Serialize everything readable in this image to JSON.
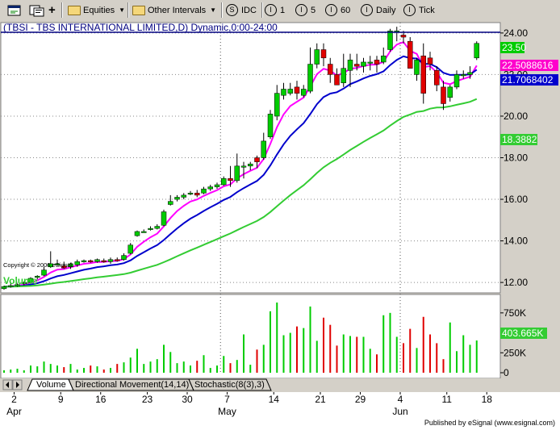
{
  "toolbar": {
    "equities": "Equities",
    "intervals": "Other Intervals",
    "idc": "IDC",
    "i1": "1",
    "i5": "5",
    "i60": "60",
    "daily": "Daily",
    "tick": "Tick",
    "idc_glyph": "S",
    "i1_glyph": "I",
    "i5_glyph": "I",
    "i60_glyph": "I",
    "daily_glyph": "I",
    "tick_glyph": "I"
  },
  "chart": {
    "title": "(TBSI - TBS INTERNATIONAL LIMITED,D) Dynamic,0:00-24:00",
    "copyright": "Copyright © 2006 eSignal.",
    "price_labels": {
      "close": "23.50",
      "ma_short": "22.5088616",
      "ma_mid": "21.7068402",
      "ma_long": "18.3882"
    },
    "volume_title": "Volume",
    "volume_value": "403.665K",
    "published": "Published by eSignal (www.esignal.com)",
    "colors": {
      "up": "#00cc00",
      "down": "#e00000",
      "ma_short": "#ff00ff",
      "ma_mid": "#0000cc",
      "ma_long": "#33cc33",
      "close_label": "#00cc00",
      "ma_short_label": "#ff00cc",
      "ma_mid_label": "#0000cc",
      "ma_long_label": "#33cc33"
    }
  },
  "tabs": [
    "Volume",
    "Directional Movement(14,14)",
    "Stochastic(8(3),3)"
  ],
  "chart_data": {
    "type": "candlestick",
    "x_ticks": [
      "2",
      "9",
      "16",
      "23",
      "30",
      "7",
      "14",
      "21",
      "29",
      "4",
      "11",
      "18"
    ],
    "month_labels": [
      "Apr",
      "May",
      "Jun"
    ],
    "price_ticks": [
      "24.00",
      "22.00",
      "20.00",
      "18.00",
      "16.00",
      "14.00",
      "12.00"
    ],
    "volume_ticks": [
      "750K",
      "500K",
      "250K",
      "0"
    ],
    "ylim": [
      11.5,
      24.5
    ],
    "volume_ylim": [
      0,
      900
    ],
    "candles": [
      {
        "o": 11.7,
        "h": 11.85,
        "l": 11.65,
        "c": 11.8,
        "v": 30
      },
      {
        "o": 11.8,
        "h": 11.95,
        "l": 11.75,
        "c": 11.85,
        "v": 40
      },
      {
        "o": 11.85,
        "h": 11.95,
        "l": 11.8,
        "c": 11.9,
        "v": 50
      },
      {
        "o": 11.95,
        "h": 12.05,
        "l": 11.85,
        "c": 12.0,
        "v": 30
      },
      {
        "o": 12.0,
        "h": 12.25,
        "l": 11.95,
        "c": 12.2,
        "v": 90
      },
      {
        "o": 12.25,
        "h": 12.35,
        "l": 12.15,
        "c": 12.3,
        "v": 80
      },
      {
        "o": 12.35,
        "h": 12.75,
        "l": 12.3,
        "c": 12.6,
        "v": 140
      },
      {
        "o": 12.75,
        "h": 13.5,
        "l": 12.7,
        "c": 12.9,
        "v": 110
      },
      {
        "o": 12.9,
        "h": 13.1,
        "l": 12.8,
        "c": 12.9,
        "v": 90
      },
      {
        "o": 12.8,
        "h": 13.0,
        "l": 12.65,
        "c": 12.7,
        "v": 70
      },
      {
        "o": 12.75,
        "h": 12.95,
        "l": 12.65,
        "c": 12.9,
        "v": 110
      },
      {
        "o": 12.85,
        "h": 13.1,
        "l": 12.75,
        "c": 13.0,
        "v": 40
      },
      {
        "o": 13.0,
        "h": 13.1,
        "l": 12.95,
        "c": 13.05,
        "v": 60
      },
      {
        "o": 13.05,
        "h": 13.1,
        "l": 12.95,
        "c": 13.0,
        "v": 90
      },
      {
        "o": 13.0,
        "h": 13.15,
        "l": 12.95,
        "c": 13.1,
        "v": 80
      },
      {
        "o": 13.05,
        "h": 13.15,
        "l": 12.95,
        "c": 13.0,
        "v": 40
      },
      {
        "o": 13.0,
        "h": 13.2,
        "l": 12.9,
        "c": 13.1,
        "v": 60
      },
      {
        "o": 13.1,
        "h": 13.2,
        "l": 13.0,
        "c": 13.05,
        "v": 110
      },
      {
        "o": 13.1,
        "h": 13.4,
        "l": 13.05,
        "c": 13.3,
        "v": 130
      },
      {
        "o": 13.4,
        "h": 13.9,
        "l": 13.35,
        "c": 13.8,
        "v": 190
      },
      {
        "o": 14.25,
        "h": 14.5,
        "l": 14.2,
        "c": 14.45,
        "v": 300
      },
      {
        "o": 14.45,
        "h": 14.55,
        "l": 14.4,
        "c": 14.45,
        "v": 110
      },
      {
        "o": 14.55,
        "h": 14.7,
        "l": 14.5,
        "c": 14.6,
        "v": 140
      },
      {
        "o": 14.6,
        "h": 14.8,
        "l": 14.55,
        "c": 14.7,
        "v": 170
      },
      {
        "o": 14.75,
        "h": 15.5,
        "l": 14.7,
        "c": 15.4,
        "v": 350
      },
      {
        "o": 15.75,
        "h": 16.2,
        "l": 15.7,
        "c": 15.9,
        "v": 260
      },
      {
        "o": 16.0,
        "h": 16.2,
        "l": 15.9,
        "c": 16.1,
        "v": 120
      },
      {
        "o": 16.1,
        "h": 16.3,
        "l": 16.0,
        "c": 16.2,
        "v": 140
      },
      {
        "o": 16.25,
        "h": 16.4,
        "l": 16.2,
        "c": 16.3,
        "v": 90
      },
      {
        "o": 16.3,
        "h": 16.45,
        "l": 16.1,
        "c": 16.2,
        "v": 150
      },
      {
        "o": 16.3,
        "h": 16.6,
        "l": 16.25,
        "c": 16.5,
        "v": 220
      },
      {
        "o": 16.5,
        "h": 16.7,
        "l": 16.4,
        "c": 16.6,
        "v": 60
      },
      {
        "o": 16.6,
        "h": 16.8,
        "l": 16.5,
        "c": 16.7,
        "v": 90
      },
      {
        "o": 16.7,
        "h": 17.1,
        "l": 16.65,
        "c": 17.0,
        "v": 210
      },
      {
        "o": 17.0,
        "h": 17.6,
        "l": 16.6,
        "c": 16.9,
        "v": 120
      },
      {
        "o": 16.9,
        "h": 18.2,
        "l": 16.8,
        "c": 17.6,
        "v": 160
      },
      {
        "o": 17.6,
        "h": 17.8,
        "l": 17.0,
        "c": 17.6,
        "v": 480
      },
      {
        "o": 17.6,
        "h": 17.8,
        "l": 17.4,
        "c": 17.7,
        "v": 100
      },
      {
        "o": 18.0,
        "h": 18.1,
        "l": 17.5,
        "c": 17.8,
        "v": 290
      },
      {
        "o": 18.0,
        "h": 19.2,
        "l": 17.9,
        "c": 18.8,
        "v": 350
      },
      {
        "o": 19.0,
        "h": 20.3,
        "l": 18.9,
        "c": 20.1,
        "v": 770
      },
      {
        "o": 20.0,
        "h": 21.5,
        "l": 19.8,
        "c": 21.1,
        "v": 880
      },
      {
        "o": 21.0,
        "h": 21.6,
        "l": 20.8,
        "c": 21.3,
        "v": 470
      },
      {
        "o": 21.1,
        "h": 21.6,
        "l": 21.0,
        "c": 21.3,
        "v": 500
      },
      {
        "o": 21.4,
        "h": 21.7,
        "l": 20.8,
        "c": 21.1,
        "v": 580
      },
      {
        "o": 21.0,
        "h": 21.5,
        "l": 20.9,
        "c": 21.3,
        "v": 560
      },
      {
        "o": 21.2,
        "h": 23.3,
        "l": 21.1,
        "c": 22.5,
        "v": 830
      },
      {
        "o": 22.5,
        "h": 23.5,
        "l": 22.3,
        "c": 23.2,
        "v": 400
      },
      {
        "o": 23.2,
        "h": 23.5,
        "l": 22.4,
        "c": 22.8,
        "v": 690
      },
      {
        "o": 22.5,
        "h": 22.8,
        "l": 21.6,
        "c": 22.0,
        "v": 600
      },
      {
        "o": 22.0,
        "h": 22.3,
        "l": 21.5,
        "c": 21.5,
        "v": 340
      },
      {
        "o": 21.6,
        "h": 23.0,
        "l": 21.4,
        "c": 22.3,
        "v": 480
      },
      {
        "o": 22.2,
        "h": 23.0,
        "l": 21.4,
        "c": 22.7,
        "v": 460
      },
      {
        "o": 22.5,
        "h": 23.0,
        "l": 22.2,
        "c": 22.4,
        "v": 450
      },
      {
        "o": 22.4,
        "h": 22.8,
        "l": 22.1,
        "c": 22.6,
        "v": 450
      },
      {
        "o": 22.6,
        "h": 22.9,
        "l": 22.2,
        "c": 22.6,
        "v": 300
      },
      {
        "o": 22.7,
        "h": 22.9,
        "l": 22.1,
        "c": 22.5,
        "v": 230
      },
      {
        "o": 22.6,
        "h": 23.3,
        "l": 22.5,
        "c": 22.9,
        "v": 720
      },
      {
        "o": 23.2,
        "h": 24.2,
        "l": 23.1,
        "c": 24.1,
        "v": 750
      },
      {
        "o": 24.1,
        "h": 24.3,
        "l": 23.6,
        "c": 24.1,
        "v": 450
      },
      {
        "o": 23.9,
        "h": 24.1,
        "l": 23.5,
        "c": 23.8,
        "v": 370
      },
      {
        "o": 23.6,
        "h": 23.8,
        "l": 22.3,
        "c": 22.3,
        "v": 550
      },
      {
        "o": 22.0,
        "h": 22.8,
        "l": 21.7,
        "c": 22.7,
        "v": 310
      },
      {
        "o": 22.9,
        "h": 23.5,
        "l": 20.6,
        "c": 21.1,
        "v": 700
      },
      {
        "o": 22.8,
        "h": 23.1,
        "l": 22.2,
        "c": 22.5,
        "v": 480
      },
      {
        "o": 22.2,
        "h": 22.4,
        "l": 21.2,
        "c": 21.5,
        "v": 370
      },
      {
        "o": 21.4,
        "h": 21.7,
        "l": 20.3,
        "c": 20.6,
        "v": 170
      },
      {
        "o": 20.9,
        "h": 21.5,
        "l": 20.7,
        "c": 21.4,
        "v": 630
      },
      {
        "o": 21.4,
        "h": 22.2,
        "l": 21.3,
        "c": 22.0,
        "v": 270
      },
      {
        "o": 22.0,
        "h": 22.2,
        "l": 21.8,
        "c": 22.0,
        "v": 470
      },
      {
        "o": 22.0,
        "h": 22.4,
        "l": 21.8,
        "c": 22.1,
        "v": 350
      },
      {
        "o": 22.8,
        "h": 23.6,
        "l": 22.7,
        "c": 23.5,
        "v": 404
      }
    ]
  }
}
